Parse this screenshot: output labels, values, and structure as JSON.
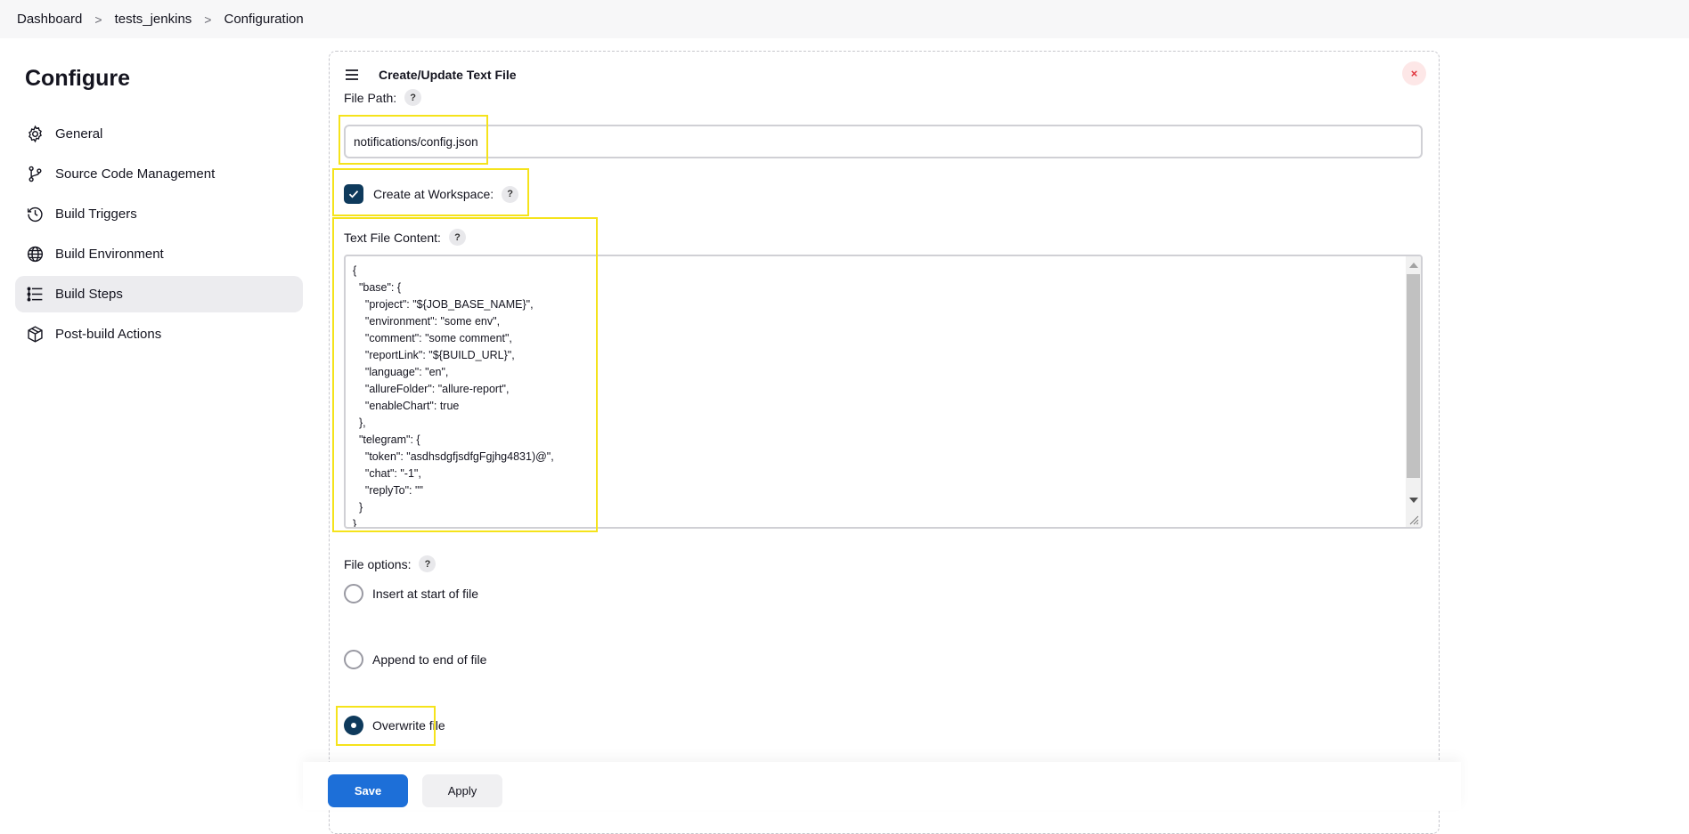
{
  "breadcrumb": {
    "items": [
      "Dashboard",
      "tests_jenkins",
      "Configuration"
    ],
    "separator": ">"
  },
  "sidebar": {
    "title": "Configure",
    "items": [
      {
        "label": "General",
        "icon": "gear-icon"
      },
      {
        "label": "Source Code Management",
        "icon": "branch-icon"
      },
      {
        "label": "Build Triggers",
        "icon": "clock-icon"
      },
      {
        "label": "Build Environment",
        "icon": "globe-icon"
      },
      {
        "label": "Build Steps",
        "icon": "list-icon",
        "active": true
      },
      {
        "label": "Post-build Actions",
        "icon": "package-icon"
      }
    ]
  },
  "step": {
    "title": "Create/Update Text File",
    "close_symbol": "×",
    "file_path": {
      "label": "File Path:",
      "value": "notifications/config.json"
    },
    "create_at_workspace": {
      "label": "Create at Workspace:",
      "checked": true
    },
    "content": {
      "label": "Text File Content:",
      "value": "{\n  \"base\": {\n    \"project\": \"${JOB_BASE_NAME}\",\n    \"environment\": \"some env\",\n    \"comment\": \"some comment\",\n    \"reportLink\": \"${BUILD_URL}\",\n    \"language\": \"en\",\n    \"allureFolder\": \"allure-report\",\n    \"enableChart\": true\n  },\n  \"telegram\": {\n    \"token\": \"asdhsdgfjsdfgFgjhg4831)@\",\n    \"chat\": \"-1\",\n    \"replyTo\": \"\"\n  }\n}"
    },
    "file_options": {
      "label": "File options:",
      "options": [
        "Insert at start of file",
        "Append to end of file",
        "Overwrite file"
      ],
      "selected": "Overwrite file"
    },
    "help_symbol": "?"
  },
  "actions": {
    "save_label": "Save",
    "apply_label": "Apply"
  },
  "colors": {
    "accent": "#1d6fd8",
    "checked": "#0e3a5c",
    "highlight": "#f5e31b"
  }
}
